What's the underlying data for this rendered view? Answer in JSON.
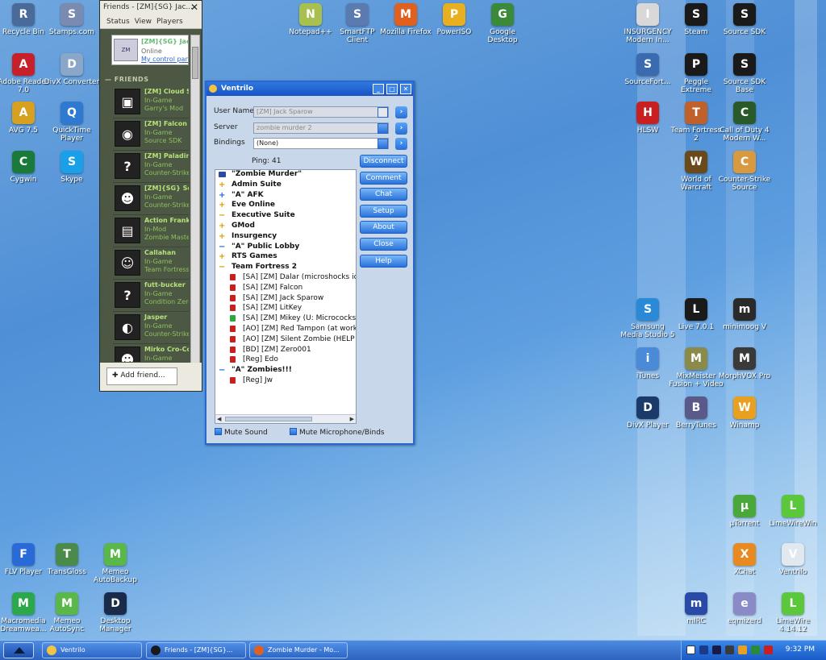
{
  "desktop_icons": [
    {
      "id": "recycle-bin",
      "label": "Recycle Bin",
      "icon": "trash-icon",
      "color": "#4a6a9a",
      "x": 0,
      "y": 0
    },
    {
      "id": "stamps",
      "label": "Stamps.com",
      "icon": "stamp-icon",
      "color": "#7a8ab0",
      "x": 0,
      "y": 0
    },
    {
      "id": "adobe",
      "label": "Adobe Reader 7.0",
      "icon": "pdf-icon",
      "color": "#c8202a"
    },
    {
      "id": "divx",
      "label": "DivX Converter",
      "icon": "divx-icon",
      "color": "#8aa6c8"
    },
    {
      "id": "avg",
      "label": "AVG 7.5",
      "icon": "shield-icon",
      "color": "#d8a020"
    },
    {
      "id": "quicktime",
      "label": "QuickTime Player",
      "icon": "quicktime-icon",
      "color": "#2d7ad0"
    },
    {
      "id": "cygwin",
      "label": "Cygwin",
      "icon": "terminal-icon",
      "color": "#1a7a3a"
    },
    {
      "id": "skype",
      "label": "Skype",
      "icon": "skype-icon",
      "color": "#1aa0e8"
    },
    {
      "id": "notepadpp",
      "label": "Notepad++",
      "icon": "notepad-icon",
      "color": "#a8c050"
    },
    {
      "id": "smartftp",
      "label": "SmartFTP Client",
      "icon": "ftp-icon",
      "color": "#5a7ab0"
    },
    {
      "id": "firefox",
      "label": "Mozilla Firefox",
      "icon": "firefox-icon",
      "color": "#e06020"
    },
    {
      "id": "poweriso",
      "label": "PowerISO",
      "icon": "disc-icon",
      "color": "#e8b020"
    },
    {
      "id": "gdesktop",
      "label": "Google Desktop",
      "icon": "google-icon",
      "color": "#3a8a3a"
    },
    {
      "id": "insurgency",
      "label": "INSURGENCY Modern In...",
      "icon": "fist-icon",
      "color": "#d8d8d8"
    },
    {
      "id": "steam",
      "label": "Steam",
      "icon": "steam-icon",
      "color": "#1a1a1a"
    },
    {
      "id": "sourcesdk",
      "label": "Source SDK",
      "icon": "steam-icon",
      "color": "#1a1a1a"
    },
    {
      "id": "sourcefort",
      "label": "SourceFort...",
      "icon": "sdk-icon",
      "color": "#3a6ab0"
    },
    {
      "id": "peggle",
      "label": "Peggle Extreme",
      "icon": "steam-icon",
      "color": "#1a1a1a"
    },
    {
      "id": "sdkbase",
      "label": "Source SDK Base",
      "icon": "steam-icon",
      "color": "#1a1a1a"
    },
    {
      "id": "hlsw",
      "label": "HLSW",
      "icon": "hlsw-icon",
      "color": "#c82020"
    },
    {
      "id": "tf2",
      "label": "Team Fortress 2",
      "icon": "tf2-icon",
      "color": "#c0602a"
    },
    {
      "id": "cod4",
      "label": "Call of Duty 4 Modern W...",
      "icon": "cod-icon",
      "color": "#2a5a2a"
    },
    {
      "id": "wow",
      "label": "World of Warcraft",
      "icon": "wow-icon",
      "color": "#6a4a1a"
    },
    {
      "id": "css",
      "label": "Counter-Strike Source",
      "icon": "cs-icon",
      "color": "#d89a40"
    },
    {
      "id": "samsung",
      "label": "Samsung Media Studio 5",
      "icon": "media-icon",
      "color": "#2a8ad8"
    },
    {
      "id": "live",
      "label": "Live 7.0.1",
      "icon": "live-icon",
      "color": "#1a1a1a"
    },
    {
      "id": "minimoog",
      "label": "minimoog V",
      "icon": "moog-icon",
      "color": "#2a2a2a"
    },
    {
      "id": "itunes",
      "label": "iTunes",
      "icon": "itunes-icon",
      "color": "#4a8ad8"
    },
    {
      "id": "mixmeister",
      "label": "MixMeister Fusion + Video",
      "icon": "mix-icon",
      "color": "#8a8a4a"
    },
    {
      "id": "morphvox",
      "label": "MorphVOX Pro",
      "icon": "morph-icon",
      "color": "#3a3a3a"
    },
    {
      "id": "divxplayer",
      "label": "DivX Player",
      "icon": "play-icon",
      "color": "#1a3a6a"
    },
    {
      "id": "berrytunes",
      "label": "BerryTunes",
      "icon": "berry-icon",
      "color": "#5a5a8a"
    },
    {
      "id": "winamp",
      "label": "Winamp",
      "icon": "winamp-icon",
      "color": "#e8a020"
    },
    {
      "id": "utorrent",
      "label": "µTorrent",
      "icon": "torrent-icon",
      "color": "#4aa83a"
    },
    {
      "id": "limewirewin",
      "label": "LimeWireWin",
      "icon": "lime-icon",
      "color": "#5ac83a"
    },
    {
      "id": "xchat",
      "label": "XChat",
      "icon": "x-icon",
      "color": "#e88a20"
    },
    {
      "id": "ventrilo",
      "label": "Ventrilo",
      "icon": "headset-icon",
      "color": "#e0e8f0"
    },
    {
      "id": "mirc",
      "label": "mIRC",
      "icon": "mirc-icon",
      "color": "#2a4aa8"
    },
    {
      "id": "eqmizerd",
      "label": "eqmizerd",
      "icon": "eq-icon",
      "color": "#8a8ac8"
    },
    {
      "id": "limewire",
      "label": "LimeWire 4.14.12",
      "icon": "lime-icon",
      "color": "#5ac83a"
    },
    {
      "id": "flvplayer",
      "label": "FLV Player",
      "icon": "flv-icon",
      "color": "#2a6ad8"
    },
    {
      "id": "transgloss",
      "label": "TransGloss",
      "icon": "gloss-icon",
      "color": "#4a8a4a"
    },
    {
      "id": "memeobackup",
      "label": "Memeo AutoBackup",
      "icon": "memeo-icon",
      "color": "#5ab84a"
    },
    {
      "id": "dreamweaver",
      "label": "Macromedia Dreamwea...",
      "icon": "dw-icon",
      "color": "#2aa84a"
    },
    {
      "id": "memeosync",
      "label": "Memeo AutoSync",
      "icon": "memeo-icon",
      "color": "#5ab84a"
    },
    {
      "id": "desktopmgr",
      "label": "Desktop Manager",
      "icon": "bb-icon",
      "color": "#1a2a4a"
    }
  ],
  "friends": {
    "title": "Friends - [ZM]{SG} Jac...",
    "menu": [
      "Status",
      "View",
      "Players"
    ],
    "me": {
      "name": "[ZM]{SG} Jack Sparow",
      "status": "Online",
      "control_panel": "My control panel"
    },
    "header": "FRIENDS",
    "list": [
      {
        "name": "[ZM] Cloud Str...",
        "status": "In-Game",
        "game": "Garry's Mod",
        "avatar": "▣"
      },
      {
        "name": "[ZM] Falcon",
        "status": "In-Game",
        "game": "Source SDK",
        "avatar": "◉"
      },
      {
        "name": "[ZM] Paladin...",
        "status": "In-Game",
        "game": "Counter-Strike...",
        "avatar": "?"
      },
      {
        "name": "[ZM]{SG} Se...",
        "status": "In-Game",
        "game": "Counter-Strike...",
        "avatar": "☻"
      },
      {
        "name": "Action Frank",
        "status": "In-Mod",
        "game": "Zombie Master",
        "avatar": "▤"
      },
      {
        "name": "Callahan",
        "status": "In-Game",
        "game": "Team Fortress...",
        "avatar": "☺"
      },
      {
        "name": "futt-bucker",
        "status": "In-Game",
        "game": "Condition Zero",
        "avatar": "?"
      },
      {
        "name": "Jasper",
        "status": "In-Game",
        "game": "Counter-Strike...",
        "avatar": "◐"
      },
      {
        "name": "Mirko Cro-Co...",
        "status": "In-Game",
        "game": "",
        "avatar": "☻"
      }
    ],
    "add_friend": "Add friend..."
  },
  "ventrilo": {
    "title": "Ventrilo",
    "labels": {
      "username": "User Name",
      "server": "Server",
      "bindings": "Bindings"
    },
    "username_value": "[ZM] Jack Sparow",
    "server_value": "zombie murder 2",
    "bindings_value": "(None)",
    "ping": "Ping: 41",
    "buttons": [
      "Disconnect",
      "Comment",
      "Chat",
      "Setup",
      "About",
      "Close",
      "Help"
    ],
    "tree": [
      {
        "type": "server",
        "text": "\"Zombie Murder\""
      },
      {
        "type": "chan",
        "mark": "+",
        "text": "Admin Suite"
      },
      {
        "type": "chan",
        "mark": "+",
        "text": "\"A\" AFK",
        "color": "#1a6ad8"
      },
      {
        "type": "chan",
        "mark": "+",
        "text": "Eve Online"
      },
      {
        "type": "chan",
        "mark": "−",
        "text": "Executive Suite"
      },
      {
        "type": "chan",
        "mark": "+",
        "text": "GMod"
      },
      {
        "type": "chan",
        "mark": "+",
        "text": "Insurgency"
      },
      {
        "type": "chan",
        "mark": "−",
        "text": "\"A\" Public Lobby",
        "color": "#1a6ad8"
      },
      {
        "type": "chan",
        "mark": "+",
        "text": "RTS Games"
      },
      {
        "type": "chan",
        "mark": "−",
        "text": "Team Fortress 2"
      },
      {
        "type": "user",
        "text": "[SA] [ZM] Dalar (microshocks id STE..."
      },
      {
        "type": "user",
        "text": "[SA] [ZM] Falcon"
      },
      {
        "type": "user",
        "text": "[SA] [ZM] Jack Sparow"
      },
      {
        "type": "user",
        "text": "[SA] [ZM] LitKey"
      },
      {
        "type": "user",
        "text": "[SA] [ZM] Mikey (U: Micrococks)",
        "talking": true
      },
      {
        "type": "user",
        "text": "[AO] [ZM] Red Tampon (at work, no..."
      },
      {
        "type": "user",
        "text": "[AO] [ZM] Silent Zombie (HELP FILL..."
      },
      {
        "type": "user",
        "text": "[BD] [ZM] Zero001"
      },
      {
        "type": "user",
        "text": "[Reg] Edo"
      },
      {
        "type": "chan",
        "mark": "−",
        "text": "\"A\" Zombies!!!",
        "color": "#1a6ad8"
      },
      {
        "type": "user",
        "text": "[Reg] Jw"
      }
    ],
    "mute_sound": "Mute Sound",
    "mute_mic": "Mute Microphone/Binds"
  },
  "taskbar": {
    "tasks": [
      {
        "label": "Ventrilo",
        "icon": "headset-icon",
        "color": "#f5c342"
      },
      {
        "label": "Friends - [ZM]{SG}...",
        "icon": "steam-icon",
        "color": "#1a1a1a"
      },
      {
        "label": "Zombie Murder - Mo...",
        "icon": "firefox-icon",
        "color": "#e06020"
      }
    ],
    "clock": "9:32 PM"
  }
}
